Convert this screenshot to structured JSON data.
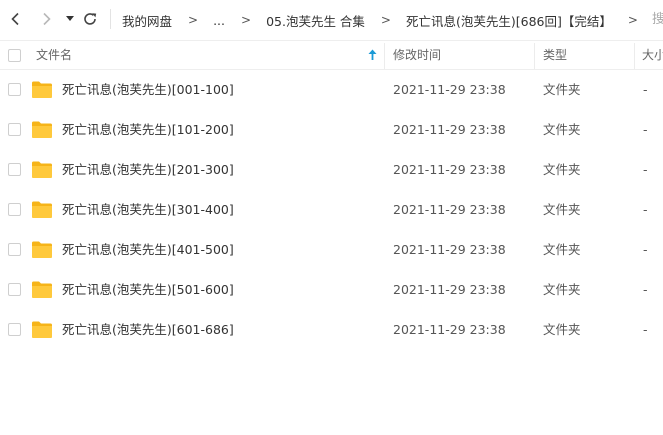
{
  "toolbar": {
    "back_icon": "chevron-left-icon",
    "forward_icon": "chevron-right-icon",
    "history_icon": "caret-down-icon",
    "refresh_icon": "refresh-icon",
    "breadcrumb": [
      {
        "label": "我的网盘"
      },
      {
        "label": "..."
      },
      {
        "label": "05.泡芙先生 合集"
      },
      {
        "label": "死亡讯息(泡芙先生)[686回]【完结】"
      }
    ],
    "separator": ">",
    "right_cut_text": "搜"
  },
  "header": {
    "name": "文件名",
    "modified": "修改时间",
    "type": "类型",
    "size": "大小",
    "sort_icon": "arrow-up-icon",
    "sort_color": "#1a9ad6"
  },
  "files": [
    {
      "name": "死亡讯息(泡芙先生)[001-100]",
      "modified": "2021-11-29 23:38",
      "type": "文件夹",
      "size": "-"
    },
    {
      "name": "死亡讯息(泡芙先生)[101-200]",
      "modified": "2021-11-29 23:38",
      "type": "文件夹",
      "size": "-"
    },
    {
      "name": "死亡讯息(泡芙先生)[201-300]",
      "modified": "2021-11-29 23:38",
      "type": "文件夹",
      "size": "-"
    },
    {
      "name": "死亡讯息(泡芙先生)[301-400]",
      "modified": "2021-11-29 23:38",
      "type": "文件夹",
      "size": "-"
    },
    {
      "name": "死亡讯息(泡芙先生)[401-500]",
      "modified": "2021-11-29 23:38",
      "type": "文件夹",
      "size": "-"
    },
    {
      "name": "死亡讯息(泡芙先生)[501-600]",
      "modified": "2021-11-29 23:38",
      "type": "文件夹",
      "size": "-"
    },
    {
      "name": "死亡讯息(泡芙先生)[601-686]",
      "modified": "2021-11-29 23:38",
      "type": "文件夹",
      "size": "-"
    }
  ],
  "colors": {
    "folder": "#ffc93c",
    "folder_tab": "#f6b419",
    "checkbox_border": "#cfcfcf"
  }
}
